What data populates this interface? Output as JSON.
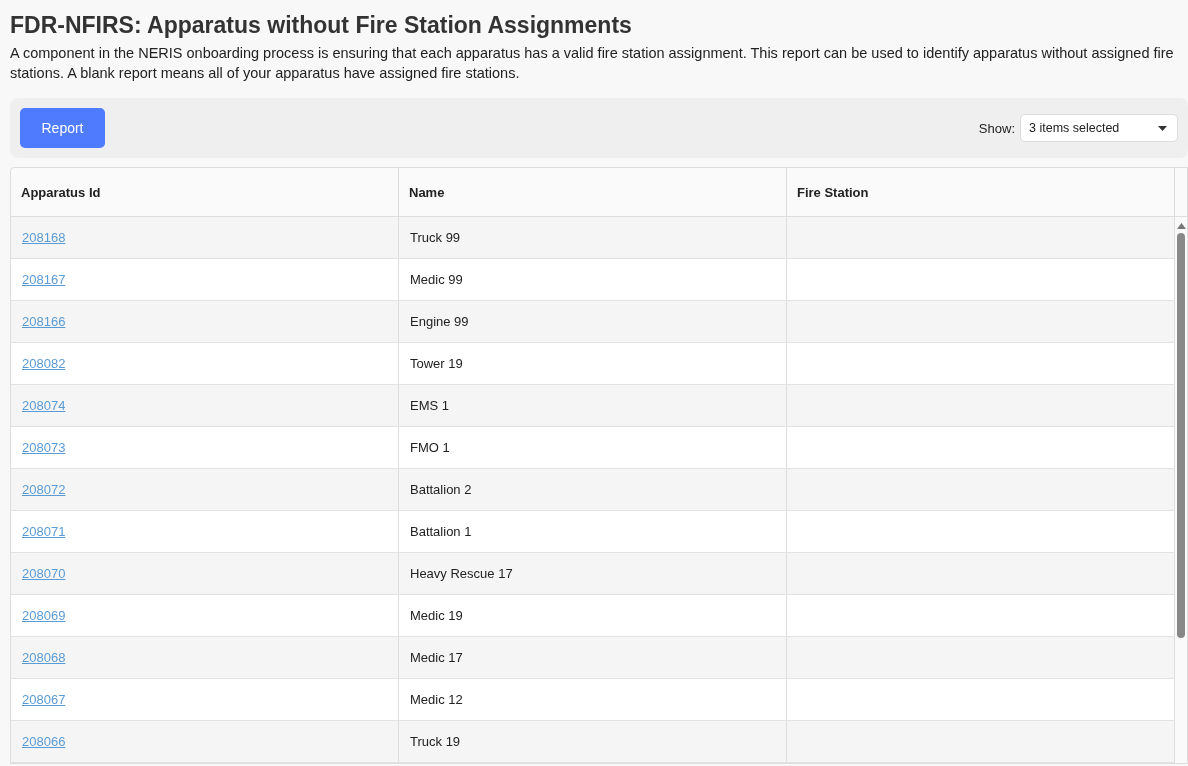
{
  "page": {
    "title": "FDR-NFIRS: Apparatus without Fire Station Assignments",
    "description": "A component in the NERIS onboarding process is ensuring that each apparatus has a valid fire station assignment. This report can be used to identify apparatus without assigned fire stations. A blank report means all of your apparatus have assigned fire stations."
  },
  "toolbar": {
    "report_button": "Report",
    "show_label": "Show:",
    "show_value": "3 items selected"
  },
  "table": {
    "columns": [
      "Apparatus Id",
      "Name",
      "Fire Station"
    ],
    "rows": [
      {
        "apparatus_id": "208168",
        "name": "Truck 99"
      },
      {
        "apparatus_id": "208167",
        "name": "Medic 99"
      },
      {
        "apparatus_id": "208166",
        "name": "Engine 99"
      },
      {
        "apparatus_id": "208082",
        "name": "Tower 19"
      },
      {
        "apparatus_id": "208074",
        "name": "EMS 1"
      },
      {
        "apparatus_id": "208073",
        "name": "FMO 1"
      },
      {
        "apparatus_id": "208072",
        "name": "Battalion 2"
      },
      {
        "apparatus_id": "208071",
        "name": "Battalion 1"
      },
      {
        "apparatus_id": "208070",
        "name": "Heavy Rescue 17"
      },
      {
        "apparatus_id": "208069",
        "name": "Medic 19"
      },
      {
        "apparatus_id": "208068",
        "name": "Medic 17"
      },
      {
        "apparatus_id": "208067",
        "name": "Medic 12"
      },
      {
        "apparatus_id": "208066",
        "name": "Truck 19"
      }
    ]
  }
}
